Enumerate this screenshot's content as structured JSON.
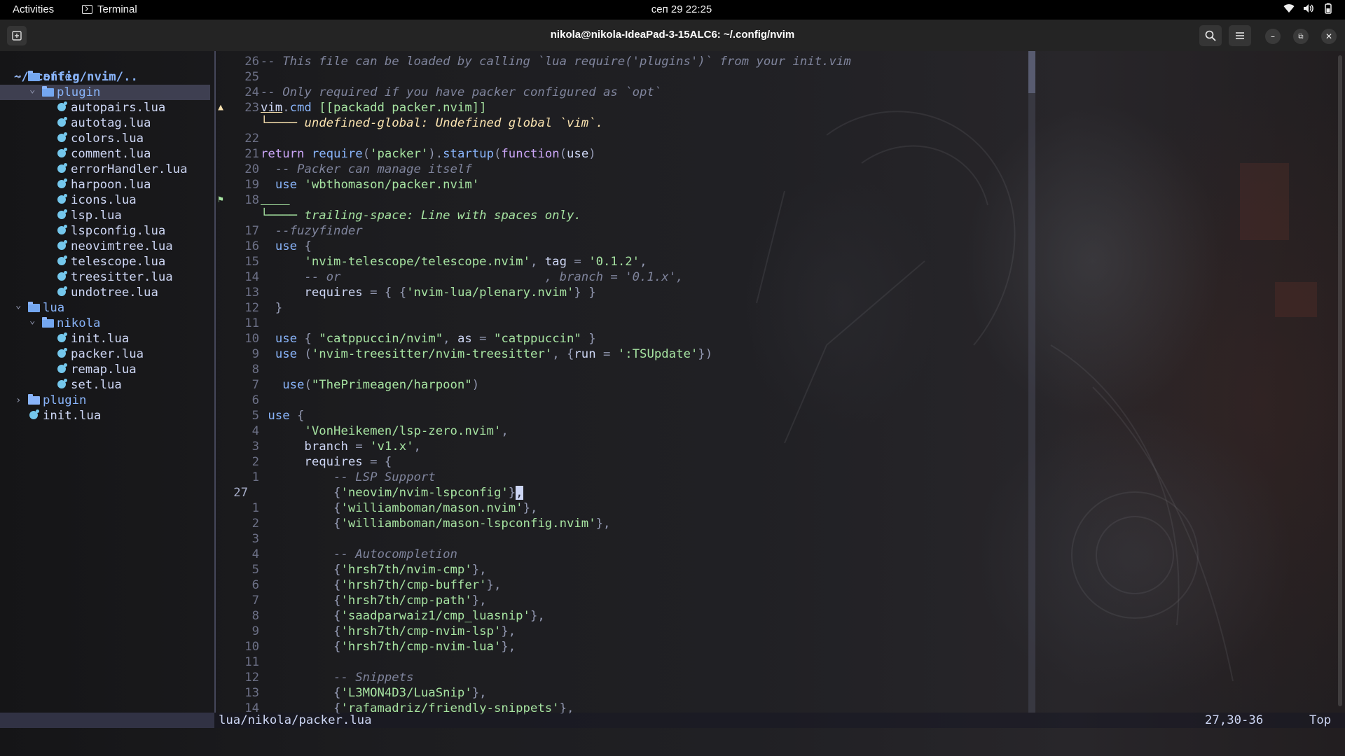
{
  "topbar": {
    "activities": "Activities",
    "app_name": "Terminal",
    "clock": "сеп 29  22:25",
    "tray_icons": [
      "wifi-icon",
      "volume-icon",
      "battery-icon"
    ]
  },
  "window": {
    "title": "nikola@nikola-IdeaPad-3-15ALC6: ~/.config/nvim",
    "buttons": [
      "new-tab-icon",
      "search-icon",
      "menu-icon",
      "minimize-icon",
      "restore-icon",
      "close-icon"
    ]
  },
  "tree": {
    "root": "~/.config/nvim/..",
    "items": [
      {
        "label": "after",
        "kind": "dir",
        "depth": 0,
        "open": true
      },
      {
        "label": "plugin",
        "kind": "dir",
        "depth": 1,
        "open": true,
        "selected": true
      },
      {
        "label": "autopairs.lua",
        "kind": "file",
        "depth": 2
      },
      {
        "label": "autotag.lua",
        "kind": "file",
        "depth": 2
      },
      {
        "label": "colors.lua",
        "kind": "file",
        "depth": 2
      },
      {
        "label": "comment.lua",
        "kind": "file",
        "depth": 2
      },
      {
        "label": "errorHandler.lua",
        "kind": "file",
        "depth": 2
      },
      {
        "label": "harpoon.lua",
        "kind": "file",
        "depth": 2
      },
      {
        "label": "icons.lua",
        "kind": "file",
        "depth": 2
      },
      {
        "label": "lsp.lua",
        "kind": "file",
        "depth": 2
      },
      {
        "label": "lspconfig.lua",
        "kind": "file",
        "depth": 2
      },
      {
        "label": "neovimtree.lua",
        "kind": "file",
        "depth": 2
      },
      {
        "label": "telescope.lua",
        "kind": "file",
        "depth": 2
      },
      {
        "label": "treesitter.lua",
        "kind": "file",
        "depth": 2
      },
      {
        "label": "undotree.lua",
        "kind": "file",
        "depth": 2
      },
      {
        "label": "lua",
        "kind": "dir",
        "depth": 0,
        "open": true
      },
      {
        "label": "nikola",
        "kind": "dir",
        "depth": 1,
        "open": true
      },
      {
        "label": "init.lua",
        "kind": "file",
        "depth": 2
      },
      {
        "label": "packer.lua",
        "kind": "file",
        "depth": 2
      },
      {
        "label": "remap.lua",
        "kind": "file",
        "depth": 2
      },
      {
        "label": "set.lua",
        "kind": "file",
        "depth": 2
      },
      {
        "label": "plugin",
        "kind": "dir",
        "depth": 0,
        "open": false
      },
      {
        "label": "init.lua",
        "kind": "file",
        "depth": 0,
        "toplevel_file": true
      }
    ]
  },
  "editor": {
    "lines": [
      {
        "num": "26",
        "segs": [
          [
            "c",
            "-- This file can be loaded by calling `lua require('plugins')` from your init.vim"
          ]
        ]
      },
      {
        "num": "25",
        "segs": []
      },
      {
        "num": "24",
        "segs": [
          [
            "c",
            "-- Only required if you have packer configured as `opt`"
          ]
        ]
      },
      {
        "num": "23",
        "sign": "warn",
        "segs": [
          [
            "vu",
            "vim"
          ],
          [
            "p",
            "."
          ],
          [
            "f",
            "cmd"
          ],
          [
            "v",
            " "
          ],
          [
            "s",
            "[[packadd packer.nvim]]"
          ]
        ]
      },
      {
        "num": "",
        "virtual": "warn",
        "segs": [
          [
            "warnline",
            "└──── "
          ],
          [
            "warntext",
            "undefined-global: Undefined global `vim`."
          ]
        ]
      },
      {
        "num": "22",
        "segs": []
      },
      {
        "num": "21",
        "segs": [
          [
            "k",
            "return "
          ],
          [
            "f",
            "require"
          ],
          [
            "p",
            "("
          ],
          [
            "s",
            "'packer'"
          ],
          [
            "p",
            ")."
          ],
          [
            "f",
            "startup"
          ],
          [
            "p",
            "("
          ],
          [
            "k",
            "function"
          ],
          [
            "p",
            "("
          ],
          [
            "v",
            "use"
          ],
          [
            "p",
            ")"
          ]
        ]
      },
      {
        "num": "20",
        "segs": [
          [
            "c",
            "  -- Packer can manage itself"
          ]
        ]
      },
      {
        "num": "19",
        "segs": [
          [
            "v",
            "  "
          ],
          [
            "f",
            "use"
          ],
          [
            "v",
            " "
          ],
          [
            "s",
            "'wbthomason/packer.nvim'"
          ]
        ]
      },
      {
        "num": "18",
        "sign": "hint",
        "segs": [
          [
            "hintu",
            "    "
          ]
        ]
      },
      {
        "num": "",
        "virtual": "hint",
        "segs": [
          [
            "hintline",
            "└──── "
          ],
          [
            "hinttext",
            "trailing-space: Line with spaces only."
          ]
        ]
      },
      {
        "num": "17",
        "segs": [
          [
            "c",
            "  --fuzyfinder"
          ]
        ]
      },
      {
        "num": "16",
        "segs": [
          [
            "v",
            "  "
          ],
          [
            "f",
            "use"
          ],
          [
            "v",
            " "
          ],
          [
            "p",
            "{"
          ]
        ]
      },
      {
        "num": "15",
        "segs": [
          [
            "v",
            "      "
          ],
          [
            "s",
            "'nvim-telescope/telescope.nvim'"
          ],
          [
            "p",
            ", "
          ],
          [
            "v",
            "tag "
          ],
          [
            "p",
            "= "
          ],
          [
            "s",
            "'0.1.2'"
          ],
          [
            "p",
            ","
          ]
        ]
      },
      {
        "num": "14",
        "segs": [
          [
            "c",
            "      -- or                            , branch = '0.1.x',"
          ]
        ]
      },
      {
        "num": "13",
        "segs": [
          [
            "v",
            "      requires "
          ],
          [
            "p",
            "= { {"
          ],
          [
            "s",
            "'nvim-lua/plenary.nvim'"
          ],
          [
            "p",
            "} }"
          ]
        ]
      },
      {
        "num": "12",
        "segs": [
          [
            "p",
            "  }"
          ]
        ]
      },
      {
        "num": "11",
        "segs": []
      },
      {
        "num": "10",
        "segs": [
          [
            "v",
            "  "
          ],
          [
            "f",
            "use"
          ],
          [
            "v",
            " "
          ],
          [
            "p",
            "{ "
          ],
          [
            "s",
            "\"catppuccin/nvim\""
          ],
          [
            "p",
            ", "
          ],
          [
            "v",
            "as "
          ],
          [
            "p",
            "= "
          ],
          [
            "s",
            "\"catppuccin\""
          ],
          [
            "p",
            " }"
          ]
        ]
      },
      {
        "num": "9",
        "segs": [
          [
            "v",
            "  "
          ],
          [
            "f",
            "use"
          ],
          [
            "v",
            " "
          ],
          [
            "p",
            "("
          ],
          [
            "s",
            "'nvim-treesitter/nvim-treesitter'"
          ],
          [
            "p",
            ", {"
          ],
          [
            "v",
            "run "
          ],
          [
            "p",
            "= "
          ],
          [
            "s",
            "':TSUpdate'"
          ],
          [
            "p",
            "})"
          ]
        ]
      },
      {
        "num": "8",
        "segs": []
      },
      {
        "num": "7",
        "segs": [
          [
            "v",
            "   "
          ],
          [
            "f",
            "use"
          ],
          [
            "p",
            "("
          ],
          [
            "s",
            "\"ThePrimeagen/harpoon\""
          ],
          [
            "p",
            ")"
          ]
        ]
      },
      {
        "num": "6",
        "segs": []
      },
      {
        "num": "5",
        "segs": [
          [
            "v",
            " "
          ],
          [
            "f",
            "use"
          ],
          [
            "v",
            " "
          ],
          [
            "p",
            "{"
          ]
        ]
      },
      {
        "num": "4",
        "segs": [
          [
            "v",
            "      "
          ],
          [
            "s",
            "'VonHeikemen/lsp-zero.nvim'"
          ],
          [
            "p",
            ","
          ]
        ]
      },
      {
        "num": "3",
        "segs": [
          [
            "v",
            "      branch "
          ],
          [
            "p",
            "= "
          ],
          [
            "s",
            "'v1.x'"
          ],
          [
            "p",
            ","
          ]
        ]
      },
      {
        "num": "2",
        "segs": [
          [
            "v",
            "      requires "
          ],
          [
            "p",
            "= {"
          ]
        ]
      },
      {
        "num": "1",
        "segs": [
          [
            "c",
            "          -- LSP Support"
          ]
        ]
      },
      {
        "num": "27",
        "current": true,
        "segs": [
          [
            "v",
            "          "
          ],
          [
            "p",
            "{"
          ],
          [
            "s",
            "'neovim/nvim-lspconfig'"
          ],
          [
            "p",
            "}"
          ],
          [
            "cursor",
            ","
          ]
        ]
      },
      {
        "num": "1",
        "segs": [
          [
            "v",
            "          "
          ],
          [
            "p",
            "{"
          ],
          [
            "s",
            "'williamboman/mason.nvim'"
          ],
          [
            "p",
            "},"
          ]
        ]
      },
      {
        "num": "2",
        "segs": [
          [
            "v",
            "          "
          ],
          [
            "p",
            "{"
          ],
          [
            "s",
            "'williamboman/mason-lspconfig.nvim'"
          ],
          [
            "p",
            "},"
          ]
        ]
      },
      {
        "num": "3",
        "segs": []
      },
      {
        "num": "4",
        "segs": [
          [
            "c",
            "          -- Autocompletion"
          ]
        ]
      },
      {
        "num": "5",
        "segs": [
          [
            "v",
            "          "
          ],
          [
            "p",
            "{"
          ],
          [
            "s",
            "'hrsh7th/nvim-cmp'"
          ],
          [
            "p",
            "},"
          ]
        ]
      },
      {
        "num": "6",
        "segs": [
          [
            "v",
            "          "
          ],
          [
            "p",
            "{"
          ],
          [
            "s",
            "'hrsh7th/cmp-buffer'"
          ],
          [
            "p",
            "},"
          ]
        ]
      },
      {
        "num": "7",
        "segs": [
          [
            "v",
            "          "
          ],
          [
            "p",
            "{"
          ],
          [
            "s",
            "'hrsh7th/cmp-path'"
          ],
          [
            "p",
            "},"
          ]
        ]
      },
      {
        "num": "8",
        "segs": [
          [
            "v",
            "          "
          ],
          [
            "p",
            "{"
          ],
          [
            "s",
            "'saadparwaiz1/cmp_luasnip'"
          ],
          [
            "p",
            "},"
          ]
        ]
      },
      {
        "num": "9",
        "segs": [
          [
            "v",
            "          "
          ],
          [
            "p",
            "{"
          ],
          [
            "s",
            "'hrsh7th/cmp-nvim-lsp'"
          ],
          [
            "p",
            "},"
          ]
        ]
      },
      {
        "num": "10",
        "segs": [
          [
            "v",
            "          "
          ],
          [
            "p",
            "{"
          ],
          [
            "s",
            "'hrsh7th/cmp-nvim-lua'"
          ],
          [
            "p",
            "},"
          ]
        ]
      },
      {
        "num": "11",
        "segs": []
      },
      {
        "num": "12",
        "segs": [
          [
            "c",
            "          -- Snippets"
          ]
        ]
      },
      {
        "num": "13",
        "segs": [
          [
            "v",
            "          "
          ],
          [
            "p",
            "{"
          ],
          [
            "s",
            "'L3MON4D3/LuaSnip'"
          ],
          [
            "p",
            "},"
          ]
        ]
      },
      {
        "num": "14",
        "segs": [
          [
            "v",
            "          "
          ],
          [
            "p",
            "{"
          ],
          [
            "s",
            "'rafamadriz/friendly-snippets'"
          ],
          [
            "p",
            "},"
          ]
        ]
      }
    ]
  },
  "statusline": {
    "file": "lua/nikola/packer.lua",
    "position": "27,30-36",
    "scroll": "Top"
  },
  "colors": {
    "warn": "#f9e2af",
    "hint": "#a6e3a1",
    "accent": "#89b4fa"
  }
}
